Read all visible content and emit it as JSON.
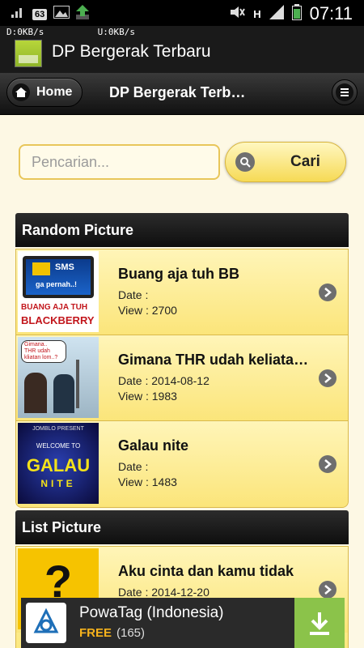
{
  "status_bar": {
    "notification_count": "63",
    "network_type": "H",
    "time": "07:11",
    "net_speed": "D:0KB/s          U:0KB/s"
  },
  "app_bar": {
    "title": "DP Bergerak Terbaru"
  },
  "header": {
    "home_label": "Home",
    "title": "DP Bergerak Terbaru"
  },
  "search": {
    "placeholder": "Pencarian...",
    "button_label": "Cari"
  },
  "random_section": {
    "heading": "Random Picture",
    "items": [
      {
        "title": "Buang aja tuh BB",
        "date": "Date :",
        "view": "View : 2700",
        "thumb_text_1": "SMS",
        "thumb_text_2": "ga pernah..!",
        "thumb_text_3": "BUANG AJA TUH",
        "thumb_text_4": "BLACKBERRY"
      },
      {
        "title": "Gimana THR udah keliatan lom..?",
        "date": "Date : 2014-08-12",
        "view": "View : 1983",
        "thumb_text_1": "Gimana..",
        "thumb_text_2": "THR udah",
        "thumb_text_3": "kliatan lom..?"
      },
      {
        "title": "Galau nite",
        "date": "Date :",
        "view": "View : 1483",
        "thumb_text_1": "JOMBLO PRESENT",
        "thumb_text_2": "WELCOME TO",
        "thumb_text_3": "GALAU",
        "thumb_text_4": "NITE"
      }
    ]
  },
  "list_section": {
    "heading": "List Picture",
    "items": [
      {
        "title": "Aku cinta dan kamu tidak",
        "date": "Date : 2014-12-20",
        "view": "",
        "thumb_text_1": "?"
      }
    ]
  },
  "ad": {
    "title": "PowaTag (Indonesia)",
    "free_label": "FREE",
    "rating_count": "(165)"
  },
  "colors": {
    "accent": "#f6da55",
    "item_bg": "#fbe77a",
    "header_bg": "#111111",
    "download_green": "#8bc34a"
  }
}
